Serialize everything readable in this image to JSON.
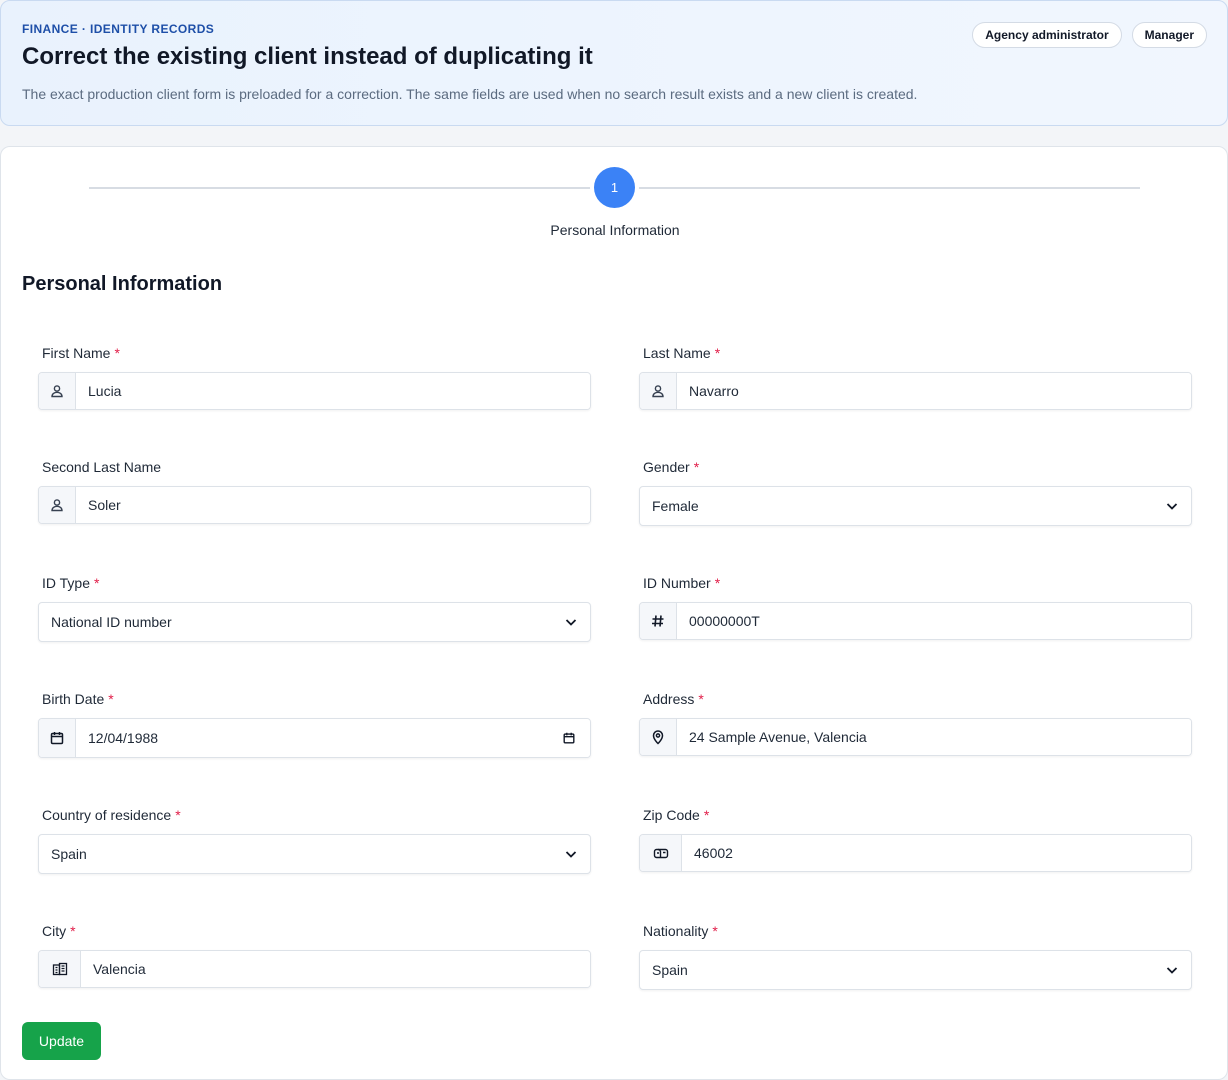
{
  "header": {
    "eyebrow": "FINANCE · IDENTITY RECORDS",
    "title": "Correct the existing client instead of duplicating it",
    "description": "The exact production client form is preloaded for a correction. The same fields are used when no search result exists and a new client is created.",
    "roles": [
      "Agency administrator",
      "Manager"
    ]
  },
  "stepper": {
    "step_number": "1",
    "step_label": "Personal Information"
  },
  "form": {
    "section_title": "Personal Information",
    "required_marker": "*",
    "first_name": {
      "label": "First Name",
      "value": "Lucia",
      "icon": "user-icon"
    },
    "last_name": {
      "label": "Last Name",
      "value": "Navarro",
      "icon": "user-icon"
    },
    "second_last_name": {
      "label": "Second Last Name",
      "value": "Soler",
      "icon": "user-icon"
    },
    "gender": {
      "label": "Gender",
      "value": "Female"
    },
    "id_type": {
      "label": "ID Type",
      "value": "National ID number"
    },
    "id_number": {
      "label": "ID Number",
      "value": "00000000T",
      "icon": "hash-icon"
    },
    "birth_date": {
      "label": "Birth Date",
      "value": "12/04/1988",
      "icon": "calendar-icon"
    },
    "address": {
      "label": "Address",
      "value": "24 Sample Avenue, Valencia",
      "icon": "map-pin-icon"
    },
    "country": {
      "label": "Country of residence",
      "value": "Spain"
    },
    "zip_code": {
      "label": "Zip Code",
      "value": "46002",
      "icon": "mailbox-icon"
    },
    "city": {
      "label": "City",
      "value": "Valencia",
      "icon": "city-icon"
    },
    "nationality": {
      "label": "Nationality",
      "value": "Spain"
    },
    "submit_label": "Update"
  },
  "colors": {
    "accent": "#3b82f6",
    "submit": "#16a34a",
    "required": "#e11d48",
    "eyebrow": "#1e4fa8"
  }
}
